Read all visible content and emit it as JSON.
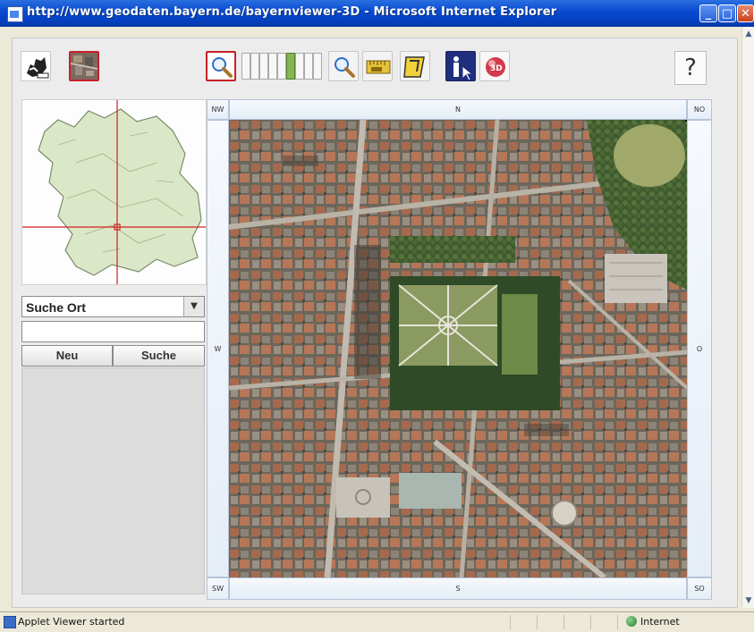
{
  "window": {
    "title": "http://www.geodaten.bayern.de/bayernviewer-3D - Microsoft Internet Explorer",
    "controls": {
      "minimize": "_",
      "maximize": "□",
      "close": "✕"
    }
  },
  "toolbar": {
    "left_tools": [
      "overview-map-icon",
      "aerial-photo-icon"
    ],
    "zoom_levels": 9,
    "zoom_active_index": 5,
    "tools": [
      "zoom-in-icon",
      "zoom-out-icon",
      "measure-icon",
      "area-measure-icon",
      "info-icon",
      "3d-icon"
    ],
    "help_label": "?"
  },
  "search": {
    "category": "Suche Ort",
    "input_value": "",
    "new_label": "Neu",
    "search_label": "Suche"
  },
  "map": {
    "compass": {
      "nw": "NW",
      "n": "N",
      "no": "NO",
      "w": "W",
      "o": "O",
      "sw": "SW",
      "s": "S",
      "so": "SO"
    }
  },
  "status": {
    "text": "Applet Viewer started",
    "zone": "Internet"
  },
  "colors": {
    "titlebar": "#0a4bd0",
    "accent_red": "#c8202a",
    "zoom_active": "#84b652"
  }
}
